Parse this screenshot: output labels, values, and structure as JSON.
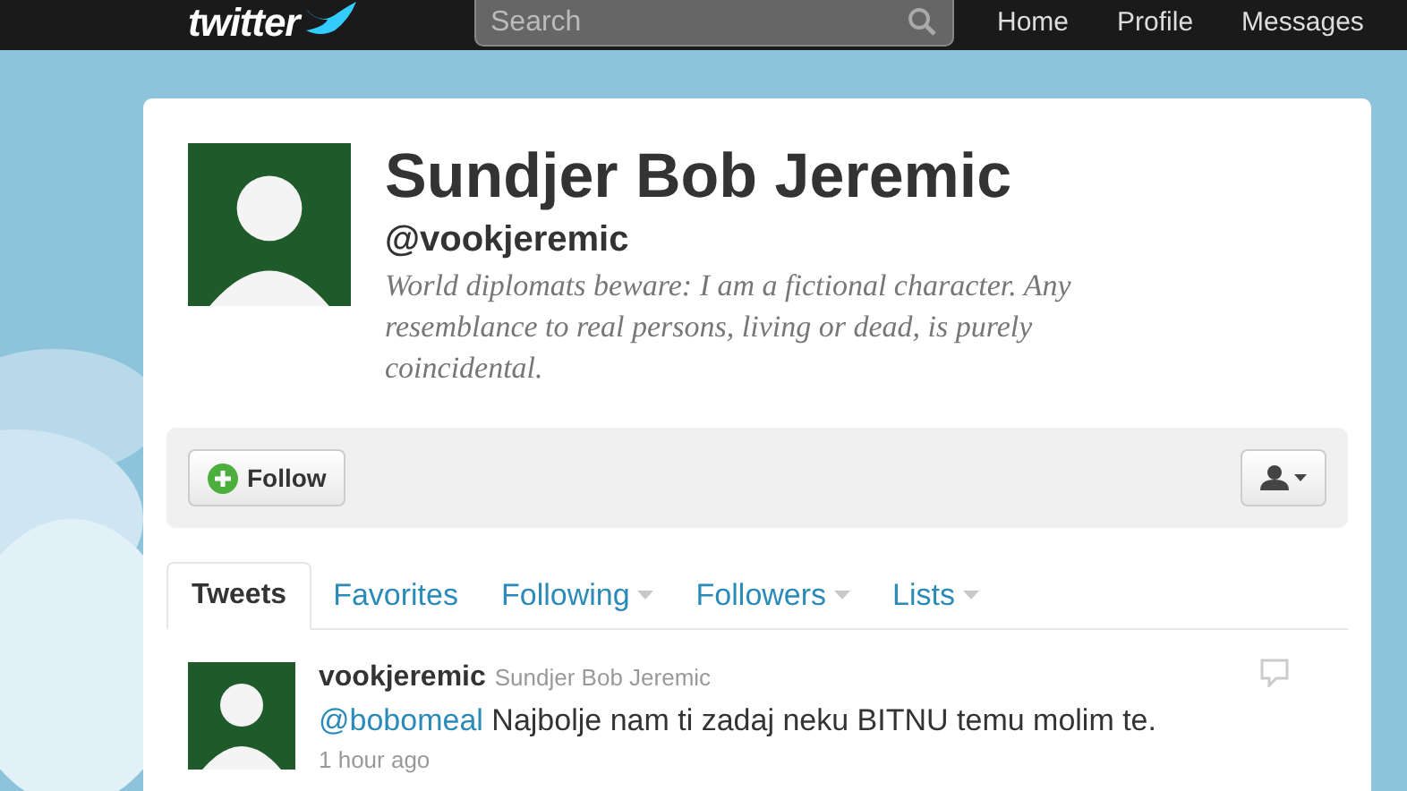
{
  "topbar": {
    "logo": "twitter",
    "search": {
      "placeholder": "Search"
    },
    "nav": [
      "Home",
      "Profile",
      "Messages"
    ]
  },
  "profile": {
    "name": "Sundjer Bob Jeremic",
    "handle": "@vookjeremic",
    "bio": "World diplomats beware: I am a fictional character. Any resemblance to real persons, living or dead, is purely coincidental."
  },
  "actions": {
    "follow": "Follow"
  },
  "tabs": [
    {
      "label": "Tweets",
      "selected": true,
      "menu": false
    },
    {
      "label": "Favorites",
      "selected": false,
      "menu": false
    },
    {
      "label": "Following",
      "selected": false,
      "menu": true
    },
    {
      "label": "Followers",
      "selected": false,
      "menu": true
    },
    {
      "label": "Lists",
      "selected": false,
      "menu": true
    }
  ],
  "tweets": [
    {
      "username": "vookjeremic",
      "fullname": "Sundjer Bob Jeremic",
      "mention": "@bobomeal",
      "text": "Najbolje nam ti zadaj neku BITNU temu molim te.",
      "time": "1 hour ago"
    }
  ]
}
